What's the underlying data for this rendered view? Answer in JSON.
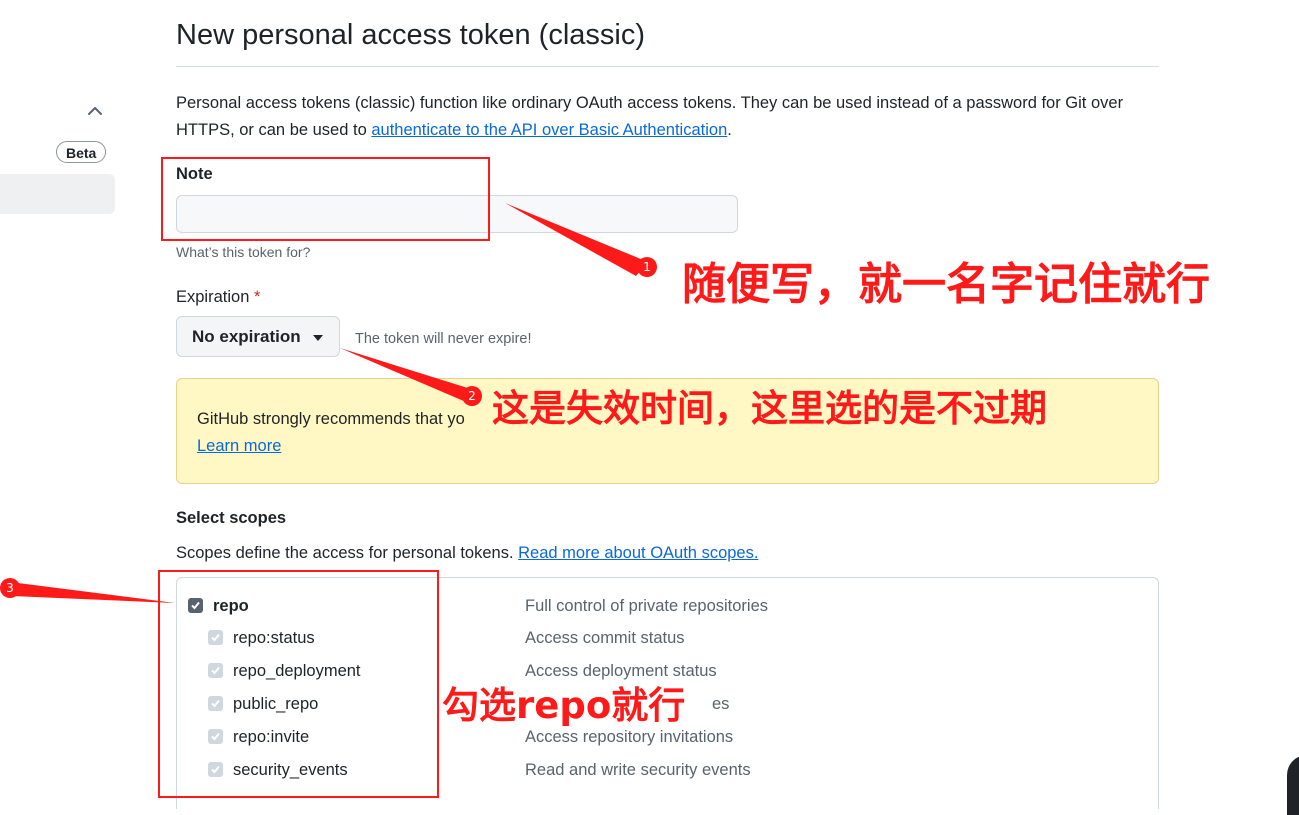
{
  "sidebar": {
    "beta_label": "Beta"
  },
  "page": {
    "title": "New personal access token (classic)"
  },
  "intro": {
    "text": "Personal access tokens (classic) function like ordinary OAuth access tokens. They can be used instead of a password for Git over HTTPS, or can be used to ",
    "link": "authenticate to the API over Basic Authentication",
    "after": "."
  },
  "note": {
    "label": "Note",
    "value": "",
    "hint": "What’s this token for?"
  },
  "expiration": {
    "label": "Expiration",
    "required_mark": "*",
    "selected": "No expiration",
    "hint": "The token will never expire!"
  },
  "warning": {
    "text": "GitHub strongly recommends that yo",
    "learn_more": "Learn more"
  },
  "scopes": {
    "heading": "Select scopes",
    "desc": "Scopes define the access for personal tokens. ",
    "desc_link": "Read more about OAuth scopes.",
    "items": [
      {
        "name": "repo",
        "desc": "Full control of private repositories",
        "checked": true,
        "level": 0
      },
      {
        "name": "repo:status",
        "desc": "Access commit status",
        "checked": true,
        "level": 1
      },
      {
        "name": "repo_deployment",
        "desc": "Access deployment status",
        "checked": true,
        "level": 1
      },
      {
        "name": "public_repo",
        "desc": "es",
        "checked": true,
        "level": 1
      },
      {
        "name": "repo:invite",
        "desc": "Access repository invitations",
        "checked": true,
        "level": 1
      },
      {
        "name": "security_events",
        "desc": "Read and write security events",
        "checked": true,
        "level": 1
      }
    ]
  },
  "annotations": {
    "note_tip": "随便写，就一名字记住就行",
    "expiration_tip": "这是失效时间，这里选的是不过期",
    "scope_tip": "勾选repo就行",
    "badge1": "1",
    "badge2": "2",
    "badge3": "3",
    "color": "#ff1a1a"
  },
  "colors": {
    "link": "#0969da",
    "warning_bg": "#fff8c5",
    "required": "#cf222e"
  }
}
